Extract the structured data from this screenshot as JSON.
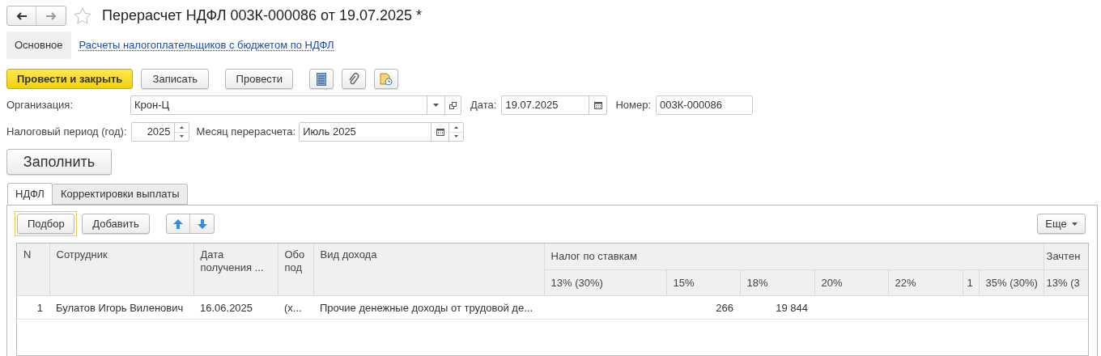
{
  "window": {
    "title": "Перерасчет НДФЛ 003К-000086 от 19.07.2025 *",
    "favorite": false
  },
  "sections": [
    {
      "label": "Основное",
      "selected": true
    },
    {
      "label": "Расчеты налогоплательщиков с бюджетом по НДФЛ",
      "selected": false
    }
  ],
  "toolbar": [
    {
      "kind": "primary",
      "label": "Провести и закрыть"
    },
    {
      "kind": "default",
      "label": "Записать"
    },
    {
      "kind": "default",
      "label": "Провести"
    },
    {
      "kind": "icon"
    },
    {
      "kind": "icon"
    },
    {
      "kind": "icon"
    }
  ],
  "organization": {
    "label": "Организация:",
    "value": "Крон-Ц"
  },
  "date": {
    "label": "Дата:",
    "value": "19.07.2025"
  },
  "number": {
    "label": "Номер:",
    "value": "003К-000086"
  },
  "tax_period": {
    "label": "Налоговый период (год):",
    "value": "2025"
  },
  "recalc_month": {
    "label": "Месяц перерасчета:",
    "value": "Июль 2025"
  },
  "fill_button": "Заполнить",
  "tabs": [
    {
      "label": "НДФЛ",
      "selected": true
    },
    {
      "label": "Корректировки выплаты",
      "selected": false
    }
  ],
  "table_toolbar": {
    "pick": "Подбор",
    "add": "Добавить",
    "more": "Еще"
  },
  "table": {
    "columns": [
      "N",
      "Сотрудник",
      "Дата получения ...",
      "Обо под",
      "Вид дохода"
    ],
    "group_header": "Налог по ставкам",
    "group_columns": [
      "13% (30%)",
      "15%",
      "18%",
      "20%",
      "22%",
      "1",
      "35% (30%)"
    ],
    "cut_group_header": "Зачтен",
    "cut_group_columns": [
      "13% (3"
    ],
    "rows": [
      {
        "cells": [
          "1",
          "Булатов Игорь Виленович",
          "16.06.2025",
          "(х...",
          "Прочие денежные доходы от трудовой де..."
        ],
        "rate_15": "266",
        "rate_18": "19 844"
      }
    ]
  }
}
